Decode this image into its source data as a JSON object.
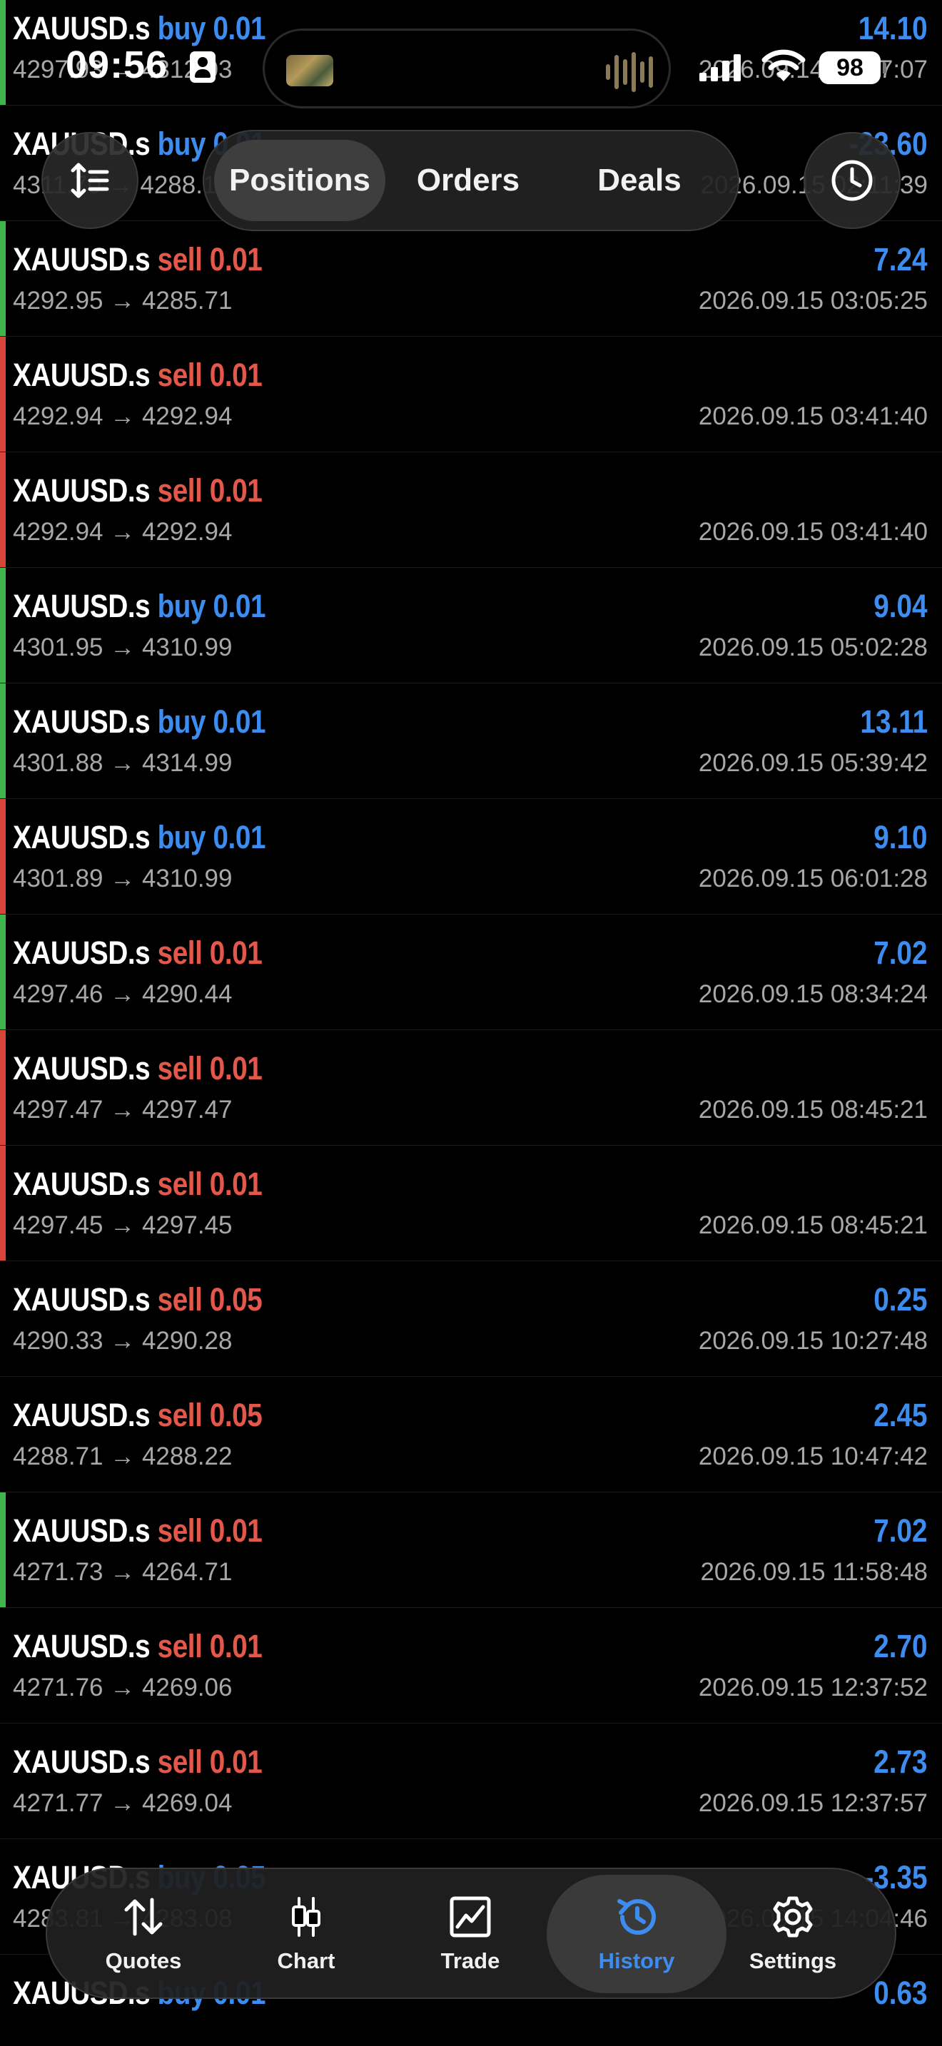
{
  "status_bar": {
    "time": "09:56",
    "battery": "98"
  },
  "top_tabs": [
    {
      "label": "Positions",
      "active": true
    },
    {
      "label": "Orders",
      "active": false
    },
    {
      "label": "Deals",
      "active": false
    }
  ],
  "trades": [
    {
      "symbol": "XAUUSD.s",
      "side": "buy",
      "volume": "0.01",
      "prices": "4297.93 → 4312.03",
      "profit": "14.10",
      "time": "2026.09.14 19:47:07",
      "marker": "green"
    },
    {
      "symbol": "XAUUSD.s",
      "side": "buy",
      "volume": "0.01",
      "prices": "4311.70 → 4288.10",
      "profit": "-23.60",
      "time": "2026.09.15 02:11:39",
      "marker": "none"
    },
    {
      "symbol": "XAUUSD.s",
      "side": "sell",
      "volume": "0.01",
      "prices": "4292.95 → 4285.71",
      "profit": "7.24",
      "time": "2026.09.15 03:05:25",
      "marker": "green"
    },
    {
      "symbol": "XAUUSD.s",
      "side": "sell",
      "volume": "0.01",
      "prices": "4292.94 → 4292.94",
      "profit": "",
      "time": "2026.09.15 03:41:40",
      "marker": "red"
    },
    {
      "symbol": "XAUUSD.s",
      "side": "sell",
      "volume": "0.01",
      "prices": "4292.94 → 4292.94",
      "profit": "",
      "time": "2026.09.15 03:41:40",
      "marker": "red"
    },
    {
      "symbol": "XAUUSD.s",
      "side": "buy",
      "volume": "0.01",
      "prices": "4301.95 → 4310.99",
      "profit": "9.04",
      "time": "2026.09.15 05:02:28",
      "marker": "green"
    },
    {
      "symbol": "XAUUSD.s",
      "side": "buy",
      "volume": "0.01",
      "prices": "4301.88 → 4314.99",
      "profit": "13.11",
      "time": "2026.09.15 05:39:42",
      "marker": "green"
    },
    {
      "symbol": "XAUUSD.s",
      "side": "buy",
      "volume": "0.01",
      "prices": "4301.89 → 4310.99",
      "profit": "9.10",
      "time": "2026.09.15 06:01:28",
      "marker": "red"
    },
    {
      "symbol": "XAUUSD.s",
      "side": "sell",
      "volume": "0.01",
      "prices": "4297.46 → 4290.44",
      "profit": "7.02",
      "time": "2026.09.15 08:34:24",
      "marker": "green"
    },
    {
      "symbol": "XAUUSD.s",
      "side": "sell",
      "volume": "0.01",
      "prices": "4297.47 → 4297.47",
      "profit": "",
      "time": "2026.09.15 08:45:21",
      "marker": "red"
    },
    {
      "symbol": "XAUUSD.s",
      "side": "sell",
      "volume": "0.01",
      "prices": "4297.45 → 4297.45",
      "profit": "",
      "time": "2026.09.15 08:45:21",
      "marker": "red"
    },
    {
      "symbol": "XAUUSD.s",
      "side": "sell",
      "volume": "0.05",
      "prices": "4290.33 → 4290.28",
      "profit": "0.25",
      "time": "2026.09.15 10:27:48",
      "marker": "none"
    },
    {
      "symbol": "XAUUSD.s",
      "side": "sell",
      "volume": "0.05",
      "prices": "4288.71 → 4288.22",
      "profit": "2.45",
      "time": "2026.09.15 10:47:42",
      "marker": "none"
    },
    {
      "symbol": "XAUUSD.s",
      "side": "sell",
      "volume": "0.01",
      "prices": "4271.73 → 4264.71",
      "profit": "7.02",
      "time": "2026.09.15 11:58:48",
      "marker": "green"
    },
    {
      "symbol": "XAUUSD.s",
      "side": "sell",
      "volume": "0.01",
      "prices": "4271.76 → 4269.06",
      "profit": "2.70",
      "time": "2026.09.15 12:37:52",
      "marker": "none"
    },
    {
      "symbol": "XAUUSD.s",
      "side": "sell",
      "volume": "0.01",
      "prices": "4271.77 → 4269.04",
      "profit": "2.73",
      "time": "2026.09.15 12:37:57",
      "marker": "none"
    },
    {
      "symbol": "XAUUSD.s",
      "side": "buy",
      "volume": "0.05",
      "prices": "4283.81 → 4283.08",
      "profit": "-3.35",
      "time": "2026.09.15 14:04:46",
      "marker": "none"
    },
    {
      "symbol": "XAUUSD.s",
      "side": "buy",
      "volume": "0.01",
      "prices": "",
      "profit": "0.63",
      "time": "",
      "marker": "none"
    }
  ],
  "bottom_nav": [
    {
      "label": "Quotes",
      "icon": "arrows-updown-icon",
      "active": false
    },
    {
      "label": "Chart",
      "icon": "candlestick-icon",
      "active": false
    },
    {
      "label": "Trade",
      "icon": "trade-chart-icon",
      "active": false
    },
    {
      "label": "History",
      "icon": "history-clock-icon",
      "active": true
    },
    {
      "label": "Settings",
      "icon": "gear-icon",
      "active": false
    }
  ],
  "colors": {
    "sell": "#e4574b",
    "buy": "#3d8cf0",
    "profit": "#3d8cf0",
    "marker_green": "#3fb54a",
    "marker_red": "#d8443a",
    "nav_active": "#3d8cf0"
  }
}
